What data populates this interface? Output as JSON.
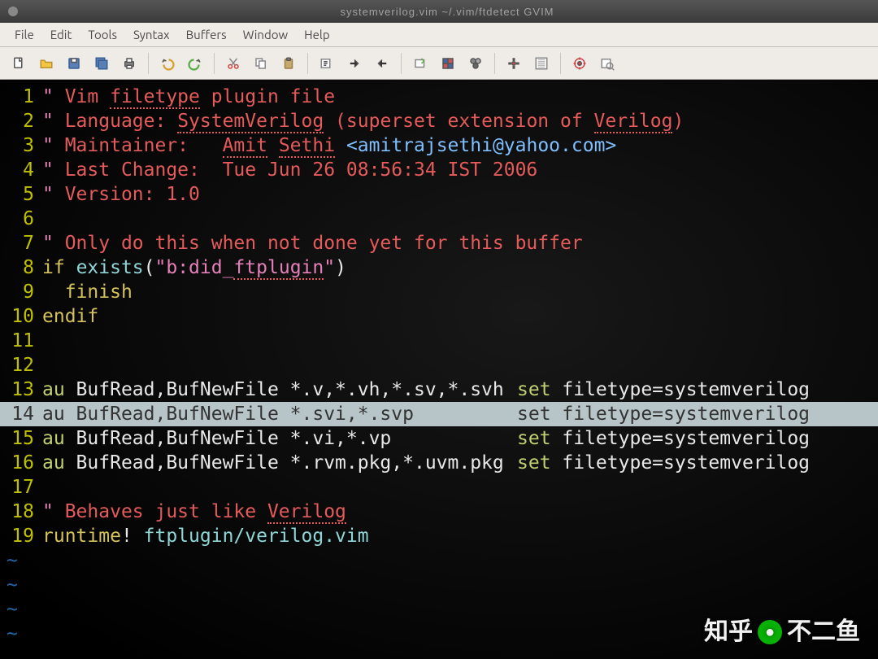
{
  "titlebar": {
    "text": "systemverilog.vim  ~/.vim/ftdetect  GVIM"
  },
  "menubar": {
    "items": [
      "File",
      "Edit",
      "Tools",
      "Syntax",
      "Buffers",
      "Window",
      "Help"
    ]
  },
  "toolbar": {
    "buttons": [
      {
        "name": "new-file-icon"
      },
      {
        "name": "open-file-icon"
      },
      {
        "name": "save-file-icon"
      },
      {
        "name": "save-all-icon"
      },
      {
        "name": "print-icon"
      },
      {
        "sep": true
      },
      {
        "name": "undo-icon"
      },
      {
        "name": "redo-icon"
      },
      {
        "sep": true
      },
      {
        "name": "cut-icon"
      },
      {
        "name": "copy-icon"
      },
      {
        "name": "paste-icon"
      },
      {
        "sep": true
      },
      {
        "name": "find-icon"
      },
      {
        "name": "find-next-icon"
      },
      {
        "name": "find-prev-icon"
      },
      {
        "sep": true
      },
      {
        "name": "make-session-icon"
      },
      {
        "name": "load-session-icon"
      },
      {
        "name": "run-script-icon"
      },
      {
        "sep": true
      },
      {
        "name": "make-icon"
      },
      {
        "name": "shell-icon"
      },
      {
        "sep": true
      },
      {
        "name": "tags-jump-icon"
      },
      {
        "name": "help-icon"
      }
    ]
  },
  "code": {
    "highlight_row": 14,
    "lines": [
      {
        "n": 1,
        "segs": [
          {
            "c": "c-quote",
            "t": "\" "
          },
          {
            "c": "c-comment",
            "t": "Vim "
          },
          {
            "c": "c-comment und",
            "t": "filetype"
          },
          {
            "c": "c-comment",
            "t": " plugin file"
          }
        ]
      },
      {
        "n": 2,
        "segs": [
          {
            "c": "c-quote",
            "t": "\" "
          },
          {
            "c": "c-comment",
            "t": "Language: "
          },
          {
            "c": "c-comment und",
            "t": "SystemVerilog"
          },
          {
            "c": "c-comment",
            "t": " (superset extension of "
          },
          {
            "c": "c-comment und",
            "t": "Verilog"
          },
          {
            "c": "c-comment",
            "t": ")"
          }
        ]
      },
      {
        "n": 3,
        "segs": [
          {
            "c": "c-quote",
            "t": "\" "
          },
          {
            "c": "c-comment",
            "t": "Maintainer:   "
          },
          {
            "c": "c-comment und",
            "t": "Amit"
          },
          {
            "c": "c-comment",
            "t": " "
          },
          {
            "c": "c-comment und",
            "t": "Sethi"
          },
          {
            "c": "c-comment",
            "t": " "
          },
          {
            "c": "c-tag",
            "t": "<amitrajsethi@yahoo.com>"
          }
        ]
      },
      {
        "n": 4,
        "segs": [
          {
            "c": "c-quote",
            "t": "\" "
          },
          {
            "c": "c-comment",
            "t": "Last Change:  Tue Jun 26 08:56:34 IST 2006"
          }
        ]
      },
      {
        "n": 5,
        "segs": [
          {
            "c": "c-quote",
            "t": "\" "
          },
          {
            "c": "c-comment",
            "t": "Version: 1.0"
          }
        ]
      },
      {
        "n": 6,
        "segs": [
          {
            "c": "c-plain",
            "t": ""
          }
        ]
      },
      {
        "n": 7,
        "segs": [
          {
            "c": "c-quote",
            "t": "\" "
          },
          {
            "c": "c-comment",
            "t": "Only do this when not done yet for this buffer"
          }
        ]
      },
      {
        "n": 8,
        "segs": [
          {
            "c": "c-key",
            "t": "if"
          },
          {
            "c": "c-plain",
            "t": " "
          },
          {
            "c": "c-ident",
            "t": "exists"
          },
          {
            "c": "c-plain",
            "t": "("
          },
          {
            "c": "c-str",
            "t": "\"b:did_"
          },
          {
            "c": "c-str und",
            "t": "ftplugin"
          },
          {
            "c": "c-str",
            "t": "\""
          },
          {
            "c": "c-plain",
            "t": ")"
          }
        ]
      },
      {
        "n": 9,
        "segs": [
          {
            "c": "c-plain",
            "t": "  "
          },
          {
            "c": "c-key",
            "t": "finish"
          }
        ]
      },
      {
        "n": 10,
        "segs": [
          {
            "c": "c-key",
            "t": "endif"
          }
        ]
      },
      {
        "n": 11,
        "segs": [
          {
            "c": "c-plain",
            "t": ""
          }
        ]
      },
      {
        "n": 12,
        "segs": [
          {
            "c": "c-plain",
            "t": ""
          }
        ]
      },
      {
        "n": 13,
        "segs": [
          {
            "c": "c-cmd",
            "t": "au"
          },
          {
            "c": "c-plain",
            "t": " BufRead,BufNewFile *.v,*.vh,*.sv,*.svh"
          }
        ],
        "rt": [
          {
            "c": "c-cmd",
            "t": "set"
          },
          {
            "c": "c-plain",
            "t": " filetype=systemverilog"
          }
        ]
      },
      {
        "n": 14,
        "segs": [
          {
            "c": "c-cmd",
            "t": "au"
          },
          {
            "c": "c-plain",
            "t": " BufRead,BufNewFile *.svi,*.svp"
          }
        ],
        "rt": [
          {
            "c": "c-cmd",
            "t": "set"
          },
          {
            "c": "c-plain",
            "t": " filetype=systemverilog"
          }
        ]
      },
      {
        "n": 15,
        "segs": [
          {
            "c": "c-cmd",
            "t": "au"
          },
          {
            "c": "c-plain",
            "t": " BufRead,BufNewFile *.vi,*.vp"
          }
        ],
        "rt": [
          {
            "c": "c-cmd",
            "t": "set"
          },
          {
            "c": "c-plain",
            "t": " filetype=systemverilog"
          }
        ]
      },
      {
        "n": 16,
        "segs": [
          {
            "c": "c-cmd",
            "t": "au"
          },
          {
            "c": "c-plain",
            "t": " BufRead,BufNewFile *.rvm.pkg,*.uvm.pkg"
          }
        ],
        "rt": [
          {
            "c": "c-cmd",
            "t": "set"
          },
          {
            "c": "c-plain",
            "t": " filetype=systemverilog"
          }
        ]
      },
      {
        "n": 17,
        "segs": [
          {
            "c": "c-plain",
            "t": ""
          }
        ]
      },
      {
        "n": 18,
        "segs": [
          {
            "c": "c-quote",
            "t": "\" "
          },
          {
            "c": "c-comment",
            "t": "Behaves just like "
          },
          {
            "c": "c-comment und",
            "t": "Verilog"
          }
        ]
      },
      {
        "n": 19,
        "segs": [
          {
            "c": "c-key",
            "t": "runtime"
          },
          {
            "c": "c-plain",
            "t": "! "
          },
          {
            "c": "c-ident",
            "t": "ftplugin/verilog.vim"
          }
        ]
      }
    ],
    "tilde_rows": 4
  },
  "watermark": {
    "left": "知乎",
    "right": "不二鱼"
  }
}
